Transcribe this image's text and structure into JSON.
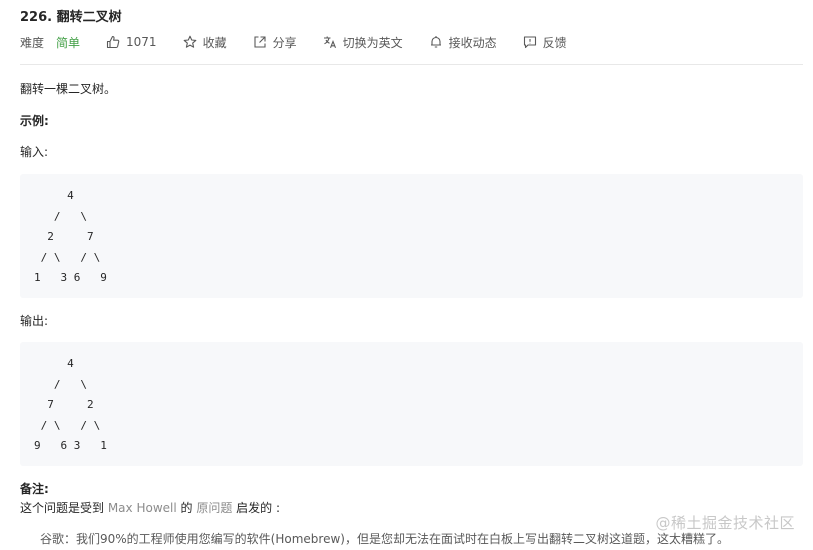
{
  "problem": {
    "title": "226. 翻转二叉树",
    "difficulty_label": "难度",
    "difficulty": "简单",
    "likes": "1071",
    "actions": {
      "favorite": "收藏",
      "share": "分享",
      "switch_lang": "切换为英文",
      "notify": "接收动态",
      "feedback": "反馈"
    }
  },
  "content": {
    "intro": "翻转一棵二叉树。",
    "example_heading": "示例:",
    "input_label": "输入:",
    "input_code": "     4\n   /   \\\n  2     7\n / \\   / \\\n1   3 6   9",
    "output_label": "输出:",
    "output_code": "     4\n   /   \\\n  7     2\n / \\   / \\\n9   6 3   1",
    "note_heading": "备注:",
    "note_prefix": "这个问题是受到 ",
    "note_author": "Max Howell",
    "note_middle": " 的 ",
    "note_link": "原问题",
    "note_suffix": " 启发的 :",
    "quote": "谷歌：我们90%的工程师使用您编写的软件(Homebrew)，但是您却无法在面试时在白板上写出翻转二叉树这道题，这太糟糕了。"
  },
  "watermark": "@稀土掘金技术社区",
  "colors": {
    "difficulty_easy": "#43a047",
    "code_bg": "#f7f8fa",
    "link_gray": "#8c8c8c"
  }
}
